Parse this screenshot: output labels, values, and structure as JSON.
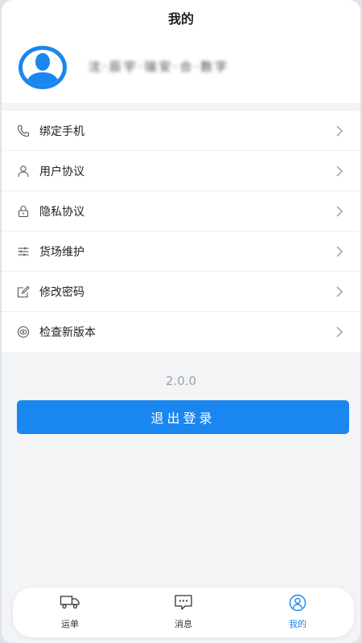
{
  "header": {
    "title": "我的"
  },
  "profile": {
    "name": "沈·辰宇·瑞安·合·数字"
  },
  "menu": {
    "items": [
      {
        "label": "绑定手机",
        "icon": "phone-icon"
      },
      {
        "label": "用户协议",
        "icon": "user-icon"
      },
      {
        "label": "隐私协议",
        "icon": "lock-icon"
      },
      {
        "label": "货场维护",
        "icon": "sliders-icon"
      },
      {
        "label": "修改密码",
        "icon": "edit-icon"
      },
      {
        "label": "检查新版本",
        "icon": "eye-icon"
      }
    ]
  },
  "version": "2.0.0",
  "logout": {
    "label": "退出登录"
  },
  "tabs": [
    {
      "label": "运单",
      "icon": "truck-icon",
      "active": false
    },
    {
      "label": "消息",
      "icon": "message-icon",
      "active": false
    },
    {
      "label": "我的",
      "icon": "profile-icon",
      "active": true
    }
  ],
  "colors": {
    "accent": "#1a86f0",
    "background": "#f3f4f6"
  }
}
